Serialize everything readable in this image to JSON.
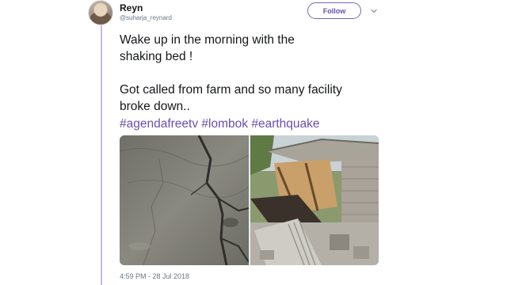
{
  "author": {
    "display_name": "Reyn",
    "handle": "@suharja_reynard"
  },
  "follow_button": {
    "label": "Follow"
  },
  "tweet": {
    "line1": "Wake up in the morning with the",
    "line2": "shaking bed !",
    "line3": "Got called from farm and so many facility",
    "line4": "broke down..",
    "hashtags": [
      "#agendafreetv",
      "#lombok",
      "#earthquake"
    ]
  },
  "timestamp": "4:59 PM - 28 Jul 2018",
  "colors": {
    "accent": "#6a4fb0",
    "thread_line": "#c9b8e6",
    "secondary_text": "#657786"
  }
}
